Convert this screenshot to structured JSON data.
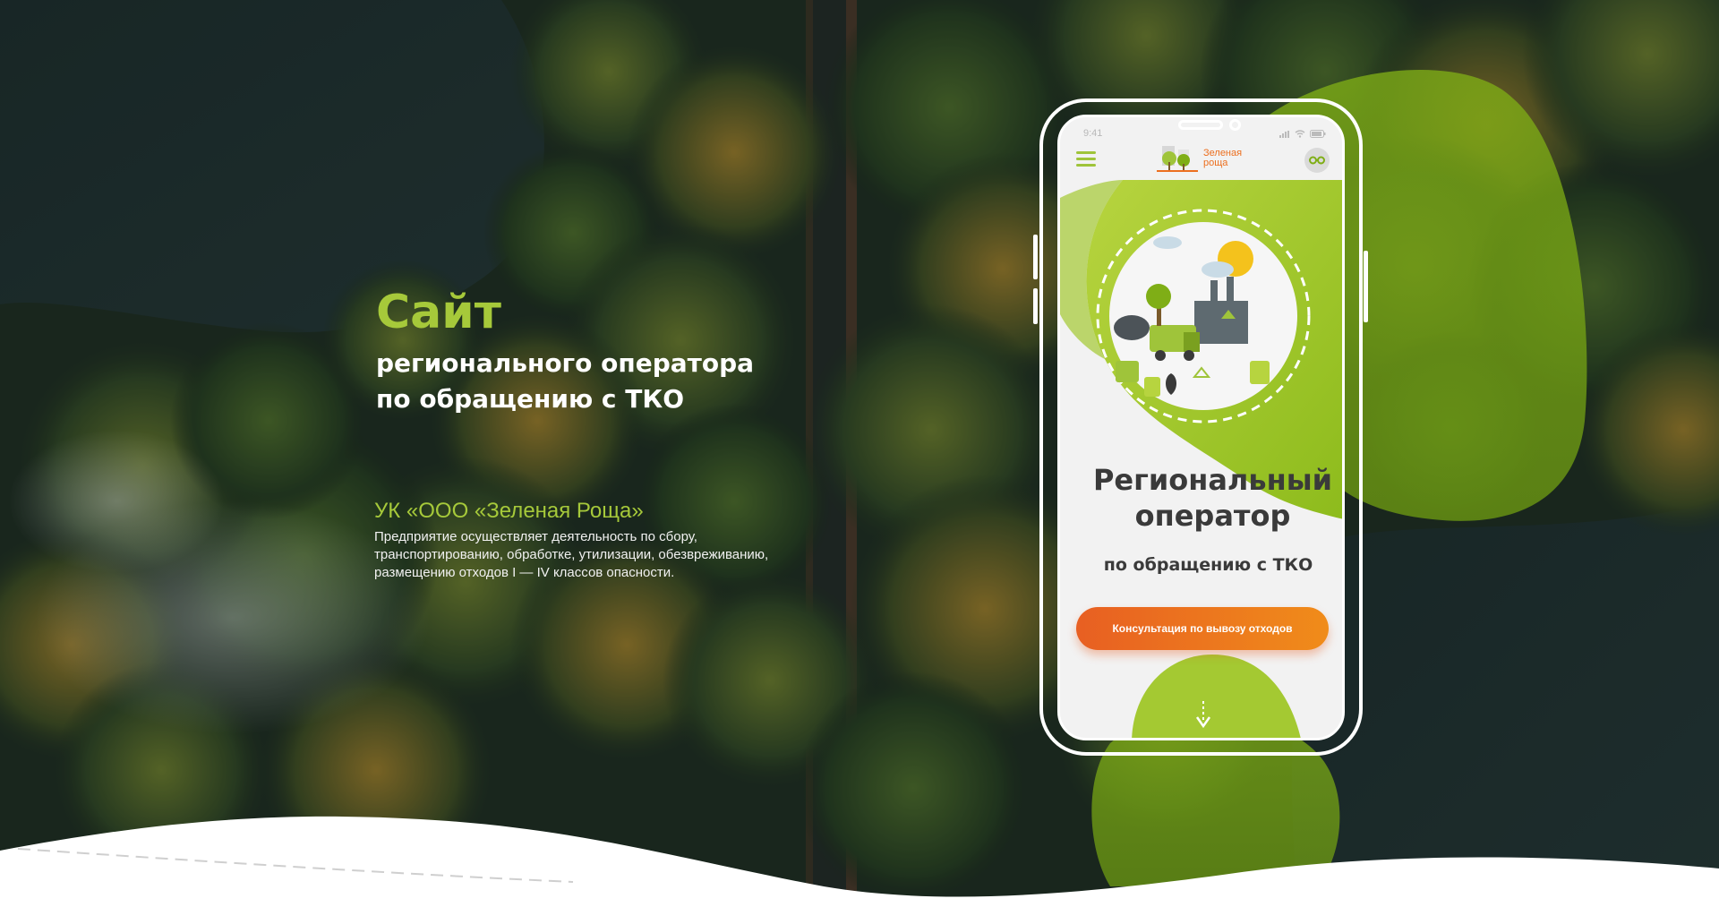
{
  "hero": {
    "title": "Сайт",
    "subtitle_line1": "регионального оператора",
    "subtitle_line2": "по обращению с ТКО"
  },
  "company": {
    "name": "УК «ООО «Зеленая Роща»",
    "description": "Предприятие осуществляет деятельность по сбору, транспортированию, обработке, утилизации, обезвреживанию, размещению отходов I — IV классов опасности."
  },
  "phone": {
    "status_time": "9:41",
    "logo_line1": "Зеленая",
    "logo_line2": "роща",
    "screen_title_line1": "Региональный",
    "screen_title_line2": "оператор",
    "screen_subtitle": "по обращению с ТКО",
    "cta_label": "Консультация по вывозу отходов"
  },
  "icons": {
    "menu": "hamburger-menu-icon",
    "eye": "low-vision-glasses-icon",
    "arrow": "arrow-down-icon",
    "logo": "green-grove-logo-icon"
  },
  "colors": {
    "accent_green": "#a6c93a",
    "accent_orange": "#ec6f1f",
    "text_dark": "#3a3a3a"
  }
}
